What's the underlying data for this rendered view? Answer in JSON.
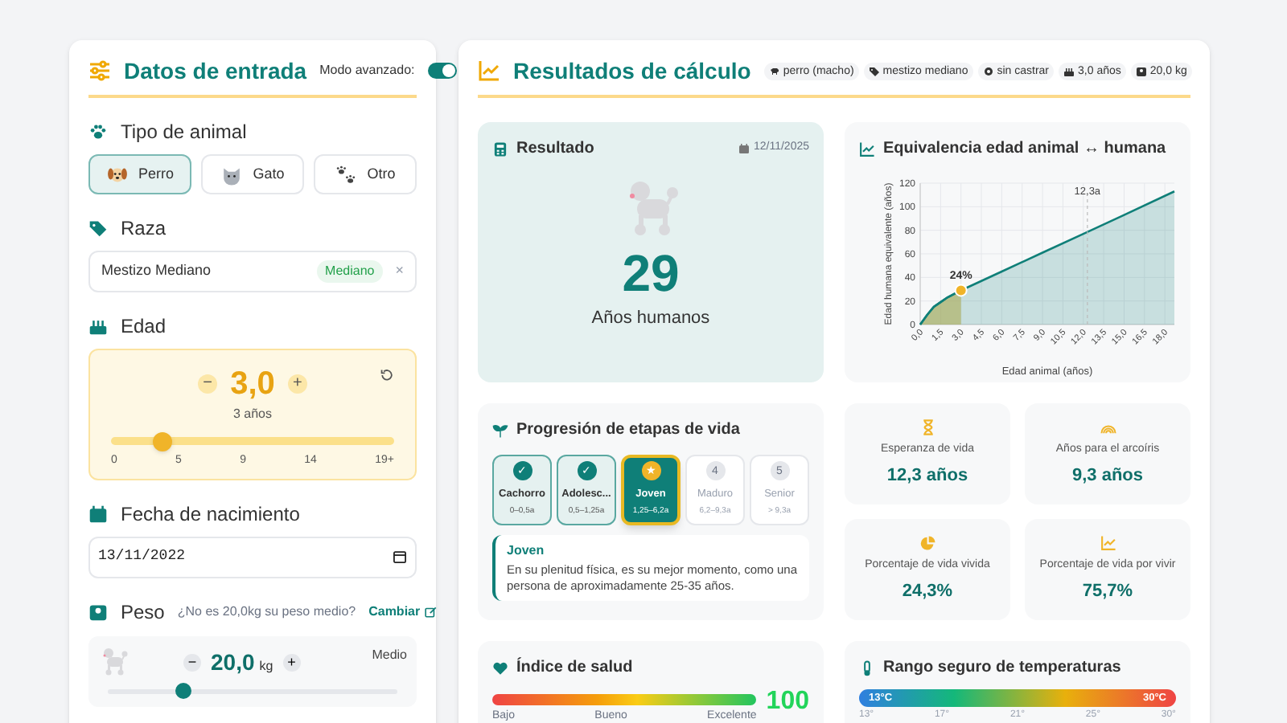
{
  "input_panel": {
    "title": "Datos de entrada",
    "advanced_mode": {
      "label": "Modo avanzado:",
      "on": true
    },
    "animal_type": {
      "title": "Tipo de animal",
      "options": [
        {
          "label": "Perro",
          "kind": "dog",
          "selected": true
        },
        {
          "label": "Gato",
          "kind": "cat",
          "selected": false
        },
        {
          "label": "Otro",
          "kind": "paws",
          "selected": false
        }
      ]
    },
    "breed": {
      "title": "Raza",
      "value": "Mestizo Mediano",
      "badge": "Mediano",
      "clear": "×"
    },
    "age": {
      "title": "Edad",
      "minus": "−",
      "value": "3,0",
      "plus": "+",
      "caption": "3 años",
      "level": 0.18,
      "ticks": [
        "0",
        "5",
        "9",
        "14",
        "19+"
      ]
    },
    "birth_date": {
      "title": "Fecha de nacimiento",
      "value": "13/11/2022"
    },
    "weight": {
      "title": "Peso",
      "question": "¿No es 20,0kg su peso medio?",
      "change": "Cambiar",
      "minus": "−",
      "value": "20,0",
      "unit": "kg",
      "plus": "+",
      "size": "Medio",
      "level": 0.26
    }
  },
  "results_panel": {
    "title": "Resultados de cálculo",
    "chips": [
      {
        "kind": "dog",
        "label": "perro (macho)"
      },
      {
        "kind": "tag",
        "label": "mestizo mediano"
      },
      {
        "kind": "gear",
        "label": "sin castrar"
      },
      {
        "kind": "cake",
        "label": "3,0 años"
      },
      {
        "kind": "scale",
        "label": "20,0 kg"
      }
    ],
    "result": {
      "title": "Resultado",
      "date": "12/11/2025",
      "value": "29",
      "caption": "Años humanos"
    },
    "chart": {
      "title": "Equivalencia edad animal ↔ humana",
      "chart_data": {
        "type": "area",
        "xlabel": "Edad animal (años)",
        "ylabel": "Edad humana equivalente (años)",
        "x": [
          0,
          0.5,
          1,
          1.5,
          2,
          2.5,
          3,
          6,
          9,
          12,
          15,
          18.7
        ],
        "series": [
          {
            "color": "#0f7f78",
            "values": [
              0,
              8,
              15,
              19,
              23,
              26,
              29,
              45,
              61,
              77,
              93,
              113
            ]
          },
          {
            "color": "#d4b84a",
            "values": [
              0,
              8,
              15,
              19,
              23,
              26,
              29,
              null,
              null,
              null,
              null,
              null
            ]
          }
        ],
        "grid": true,
        "xlim": [
          0,
          18.7
        ],
        "ylim": [
          0,
          120
        ],
        "xticks": [
          {
            "value": 0,
            "label": "0,0"
          },
          {
            "value": 1.5,
            "label": "1,5"
          },
          {
            "value": 3,
            "label": "3,0"
          },
          {
            "value": 4.5,
            "label": "4,5"
          },
          {
            "value": 6,
            "label": "6,0"
          },
          {
            "value": 7.5,
            "label": "7,5"
          },
          {
            "value": 9,
            "label": "9,0"
          },
          {
            "value": 10.5,
            "label": "10,5"
          },
          {
            "value": 12,
            "label": "12,0"
          },
          {
            "value": 13.5,
            "label": "13,5"
          },
          {
            "value": 15,
            "label": "15,0"
          },
          {
            "value": 16.5,
            "label": "16,5"
          },
          {
            "value": 18,
            "label": "18,0"
          }
        ],
        "yticks": [
          0,
          20,
          40,
          60,
          80,
          100,
          120
        ],
        "annotations": [
          {
            "x": 3,
            "y": 29,
            "text": "24%"
          }
        ],
        "ref_lines": [
          {
            "axis": "x",
            "value": 12.3,
            "label": "12,3a"
          }
        ]
      }
    },
    "stages": {
      "title": "Progresión de etapas de vida",
      "items": [
        {
          "kind": "done",
          "mark": "✓",
          "name": "Cachorro",
          "range": "0–0,5a"
        },
        {
          "kind": "done",
          "mark": "✓",
          "name": "Adolesc...",
          "range": "0,5–1,25a"
        },
        {
          "kind": "current",
          "mark": "★",
          "name": "Joven",
          "range": "1,25–6,2a"
        },
        {
          "kind": "pending",
          "mark": "4",
          "name": "Maduro",
          "range": "6,2–9,3a"
        },
        {
          "kind": "pending",
          "mark": "5",
          "name": "Senior",
          "range": "> 9,3a"
        }
      ],
      "detail": {
        "title": "Joven",
        "text": "En su plenitud física, es su mejor momento, como una persona de aproximadamente 25-35 años."
      }
    },
    "stats": [
      {
        "kind": "hourglass",
        "label": "Esperanza de vida",
        "value": "12,3 años"
      },
      {
        "kind": "rainbow",
        "label": "Años para el arcoíris",
        "value": "9,3 años"
      },
      {
        "kind": "pie",
        "label": "Porcentaje de vida vivida",
        "value": "24,3%"
      },
      {
        "kind": "trend",
        "label": "Porcentaje de vida por vivir",
        "value": "75,7%"
      }
    ],
    "health": {
      "title": "Índice de salud",
      "labels": [
        "Bajo",
        "Bueno",
        "Excelente"
      ],
      "value": "100"
    },
    "temperature": {
      "title": "Rango seguro de temperaturas",
      "min": "13°C",
      "max": "30°C",
      "ticks": [
        "13°",
        "17°",
        "21°",
        "25°",
        "30°"
      ]
    }
  }
}
